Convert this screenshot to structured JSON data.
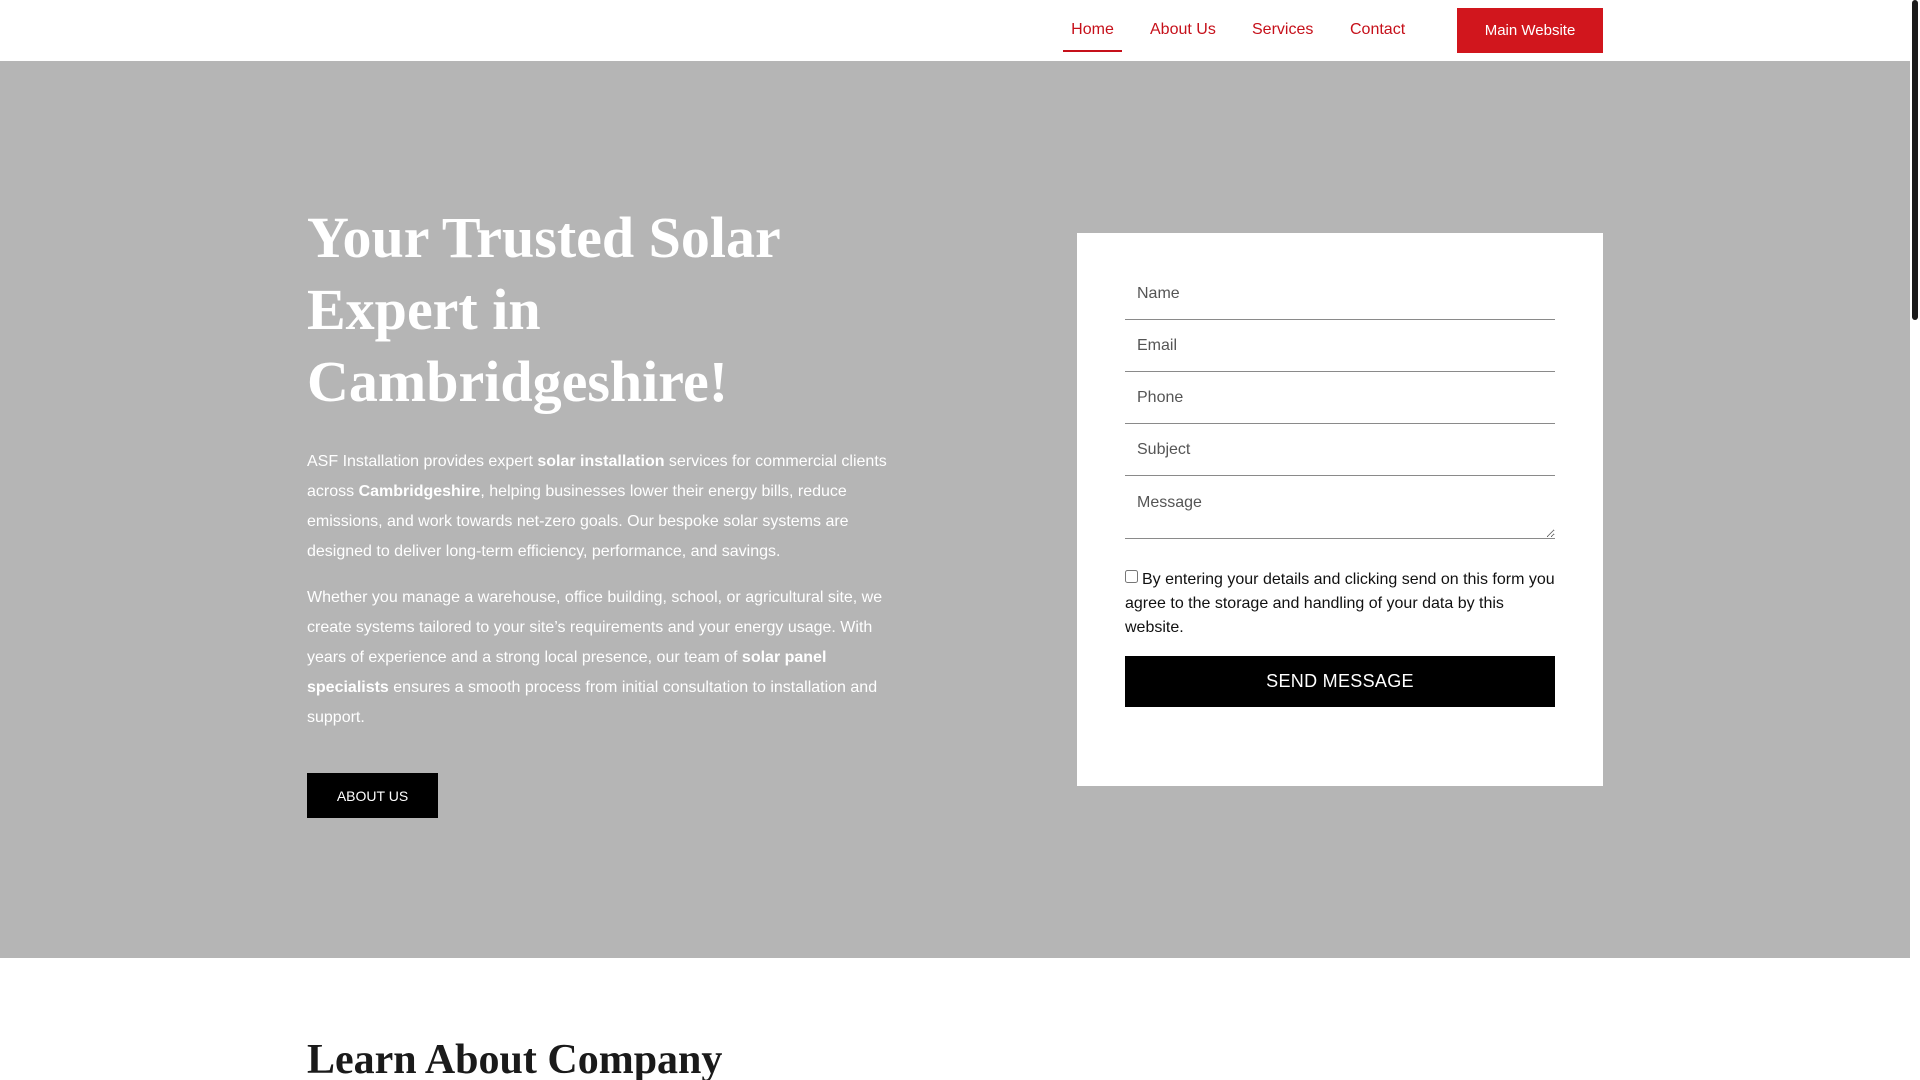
{
  "nav": {
    "items": [
      {
        "label": "Home",
        "active": true
      },
      {
        "label": "About Us",
        "active": false
      },
      {
        "label": "Services",
        "active": false
      },
      {
        "label": "Contact",
        "active": false
      }
    ],
    "cta_label": "Main Website"
  },
  "hero": {
    "title": "Your Trusted Solar Expert in Cambridgeshire!",
    "p1": {
      "t1": "ASF Installation provides expert ",
      "b1": "solar installation",
      "t2": " services for commercial clients across ",
      "b2": "Cambridgeshire",
      "t3": ", helping businesses lower their energy bills, reduce emissions, and work towards net-zero goals. Our bespoke solar systems are designed to deliver long-term efficiency, performance, and savings."
    },
    "p2": {
      "t1": "Whether you manage a warehouse, office building, school, or agricultural site, we create systems tailored to your site’s requirements and your energy usage. With years of experience and a strong local presence, our team of ",
      "b1": "solar panel specialists",
      "t2": " ensures a smooth process from initial consultation to installation and support."
    },
    "button_label": "ABOUT US"
  },
  "form": {
    "name_placeholder": "Name",
    "email_placeholder": "Email",
    "phone_placeholder": "Phone",
    "subject_placeholder": "Subject",
    "message_placeholder": "Message",
    "consent_text": "By entering your details and clicking send on this form you agree to the storage and handling of your data by this website.",
    "submit_label": "SEND MESSAGE"
  },
  "section2": {
    "title": "Learn About Company"
  },
  "colors": {
    "accent": "#c6101a",
    "hero_bg": "#b5b5b5",
    "button_dark": "#000000"
  }
}
